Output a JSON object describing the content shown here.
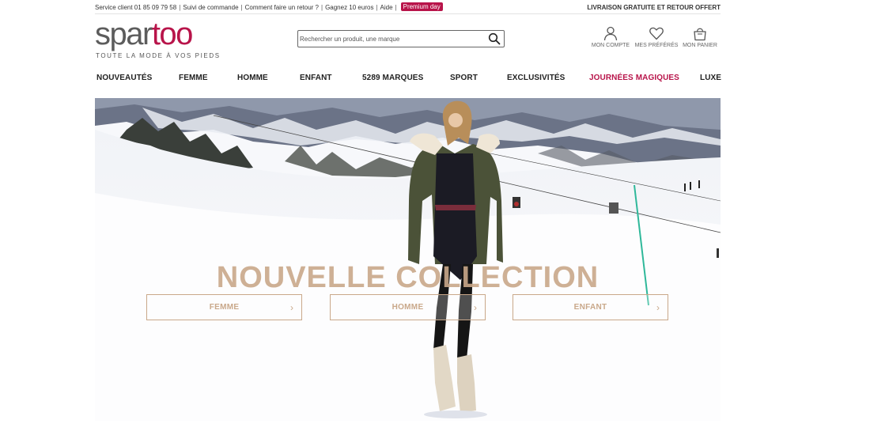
{
  "topbar": {
    "service_client": "Service client 01 85 09 79 58",
    "links": [
      "Suivi de commande",
      "Comment faire un retour ?",
      "Gagnez 10 euros",
      "Aide"
    ],
    "premium_badge": "Premium day",
    "shipping_notice": "LIVRAISON GRATUITE ET RETOUR OFFERT"
  },
  "logo": {
    "part1": "spar",
    "part2": "too",
    "tagline": "TOUTE LA MODE À VOS PIEDS"
  },
  "search": {
    "placeholder": "Rechercher un produit, une marque",
    "icon": "search-icon"
  },
  "account_links": [
    {
      "label": "MON COMPTE",
      "icon": "user-icon"
    },
    {
      "label": "MES PRÉFÉRÉS",
      "icon": "heart-icon"
    },
    {
      "label": "MON PANIER",
      "icon": "bag-icon"
    }
  ],
  "nav": {
    "items": [
      "NOUVEAUTÉS",
      "FEMME",
      "HOMME",
      "ENFANT",
      "5289 MARQUES",
      "SPORT",
      "EXCLUSIVITÉS",
      "JOURNÉES MAGIQUES",
      "LUXE"
    ],
    "highlight_color": "#b8144a"
  },
  "hero": {
    "title": "NOUVELLE COLLECTION",
    "buttons": [
      "FEMME",
      "HOMME",
      "ENFANT"
    ],
    "accent_color": "#c9a88a"
  },
  "colors": {
    "brand": "#b8144a",
    "logo_grey": "#5c5c5c"
  }
}
